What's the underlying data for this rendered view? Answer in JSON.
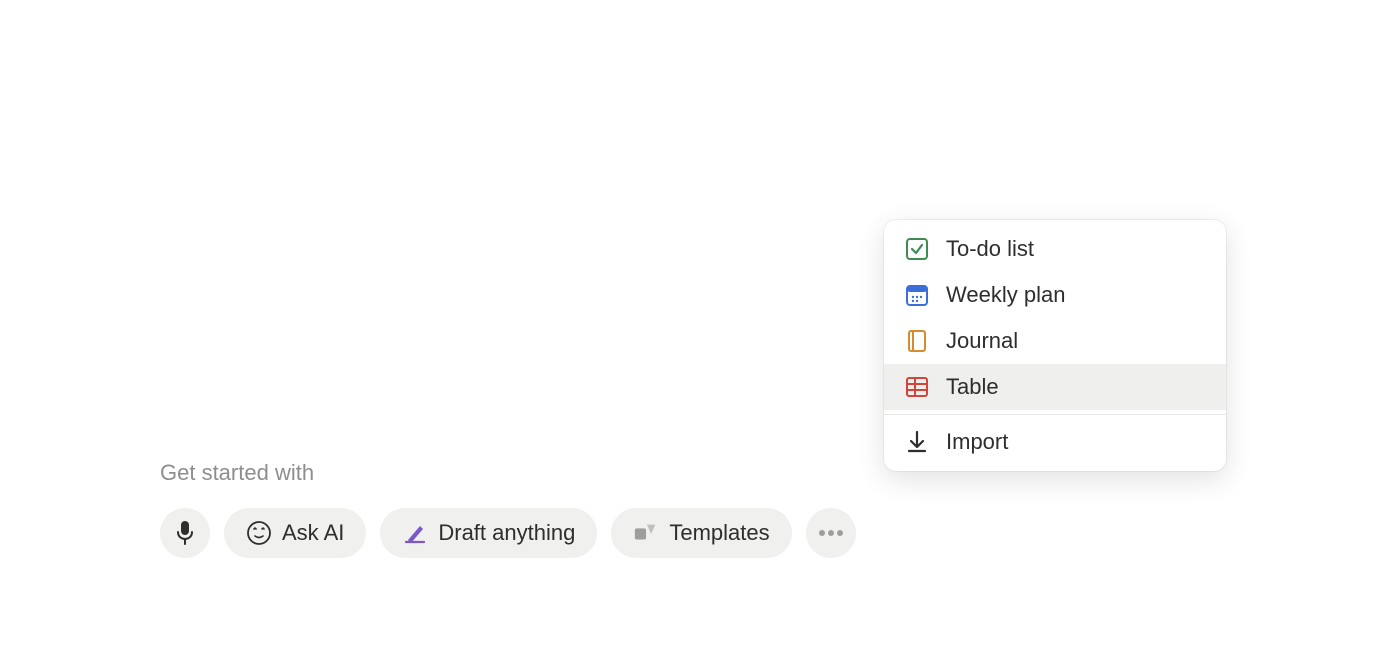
{
  "get_started_label": "Get started with",
  "buttons": {
    "ask_ai": "Ask AI",
    "draft_anything": "Draft anything",
    "templates": "Templates"
  },
  "popover": {
    "items": [
      {
        "label": "To-do list",
        "icon": "todo-icon",
        "color": "#3d8b55"
      },
      {
        "label": "Weekly plan",
        "icon": "calendar-icon",
        "color": "#3a6fd8"
      },
      {
        "label": "Journal",
        "icon": "journal-icon",
        "color": "#d68b2c"
      },
      {
        "label": "Table",
        "icon": "table-icon",
        "color": "#d1453b",
        "hovered": true
      }
    ],
    "import_label": "Import"
  }
}
